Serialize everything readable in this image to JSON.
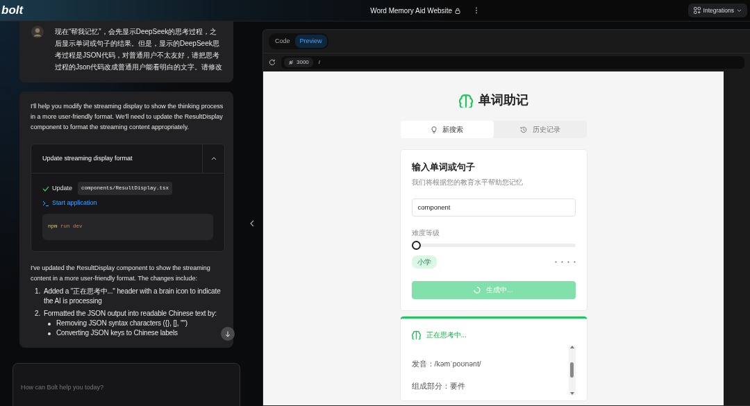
{
  "header": {
    "logo": "bolt",
    "project_title": "Word Memory Aid Website",
    "integrations_button": "Integrations"
  },
  "chat": {
    "user_message": "现在“帮我记忆”，会先显示DeepSeek的思考过程，之后显示单词或句子的结果。但是，显示的DeepSeek思考过程是JSON代码，对普通用户不太友好，请把思考过程的Json代码改成普通用户能看明白的文字。请修改",
    "assistant_intro": "I'll help you modify the streaming display to show the thinking process in a more user-friendly format. We'll need to update the ResultDisplay component to format the streaming content appropriately.",
    "action_card": {
      "title": "Update streaming display format",
      "expanded": true,
      "steps": [
        {
          "kind": "file",
          "done": true,
          "label": "Update",
          "file": "components/ResultDisplay.tsx"
        },
        {
          "kind": "command",
          "label": "Start application",
          "command": "npm run dev"
        }
      ]
    },
    "summary": "I've updated the ResultDisplay component to show the streaming content in a more user-friendly format. The changes include:",
    "list": [
      {
        "number": "1.",
        "text": "Added a \"正在思考中...\" header with a brain icon to indicate the AI is processing"
      },
      {
        "number": "2.",
        "text": "Formatted the JSON output into readable Chinese text by:",
        "children": [
          {
            "text": "Removing JSON syntax characters ({}, [], \"\")"
          },
          {
            "text": "Converting JSON keys to Chinese labels"
          }
        ]
      }
    ],
    "input_placeholder": "How can Bolt help you today?"
  },
  "preview": {
    "tabs": [
      {
        "label": "Code",
        "selected": false
      },
      {
        "label": "Preview",
        "selected": true
      }
    ],
    "port": "3000",
    "path": "/",
    "app": {
      "title": "单词助记",
      "tabs": [
        {
          "label": "新搜索",
          "selected": true
        },
        {
          "label": "历史记录",
          "selected": false
        }
      ],
      "form": {
        "heading": "输入单词或句子",
        "subheading": "我们将根据您的教育水平帮助您记忆",
        "word_value": "component",
        "difficulty_label": "难度等级",
        "difficulty": {
          "level": 0
        },
        "level_badge": "小学",
        "submit": {
          "label": "生成中...",
          "loading": true
        }
      },
      "thinking": {
        "title": "正在思考中...",
        "lines": [
          "发音：/kəmˈpoʊnənt/",
          "组成部分：要件"
        ]
      }
    }
  }
}
